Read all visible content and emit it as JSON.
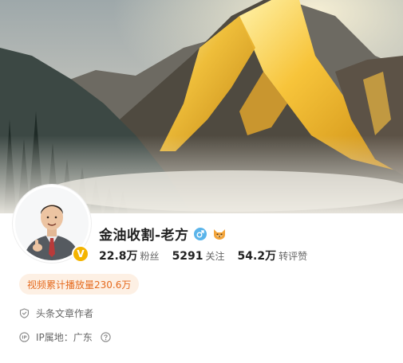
{
  "profile": {
    "name": "金油收割-老方",
    "gender_icon": "male-icon",
    "badge_icon": "fox-icon",
    "verified_icon": "verified-v-icon",
    "verified_mark": "V"
  },
  "stats": [
    {
      "value": "22.8万",
      "label": "粉丝"
    },
    {
      "value": "5291",
      "label": "关注"
    },
    {
      "value": "54.2万",
      "label": "转评赞"
    }
  ],
  "play_count": {
    "text": "视频累计播放量230.6万"
  },
  "info": {
    "author_role": "头条文章作者",
    "ip_label": "IP属地：广东"
  },
  "colors": {
    "accent_orange": "#e56a1e",
    "badge_bg": "#fdf0e4",
    "verified_gold": "#f4b400",
    "male_blue": "#5ab4ea"
  }
}
